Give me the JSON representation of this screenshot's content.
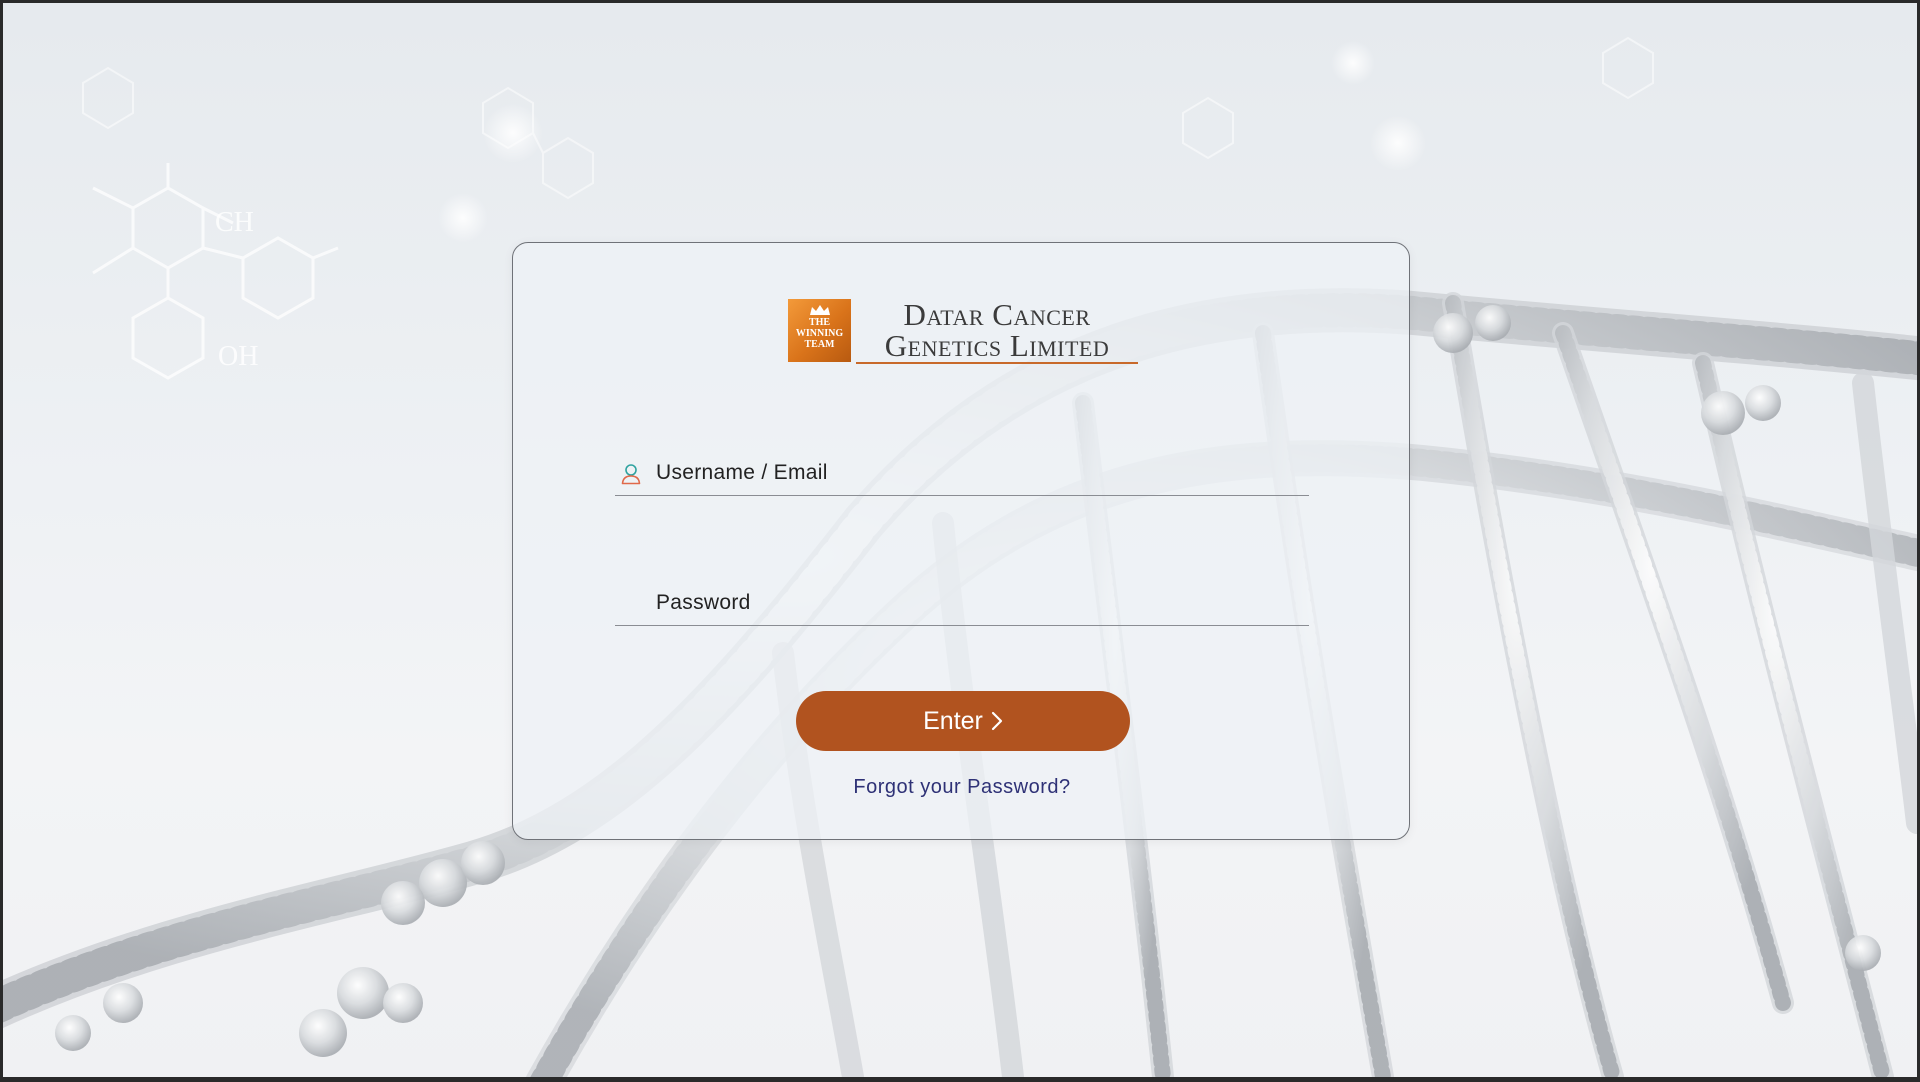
{
  "brand": {
    "badge_lines": [
      "THE",
      "WINNING",
      "TEAM"
    ],
    "name_line1": "Datar Cancer",
    "name_line2": "Genetics Limited",
    "accent_color": "#c8692a",
    "badge_color": "#e0801f"
  },
  "login": {
    "username_placeholder": "Username / Email",
    "password_placeholder": "Password",
    "username_icon": "user-icon",
    "submit_label": "Enter",
    "submit_icon": "chevron-right-icon",
    "submit_color": "#b1531f",
    "forgot_label": "Forgot your Password?",
    "forgot_color": "#2e3176"
  }
}
